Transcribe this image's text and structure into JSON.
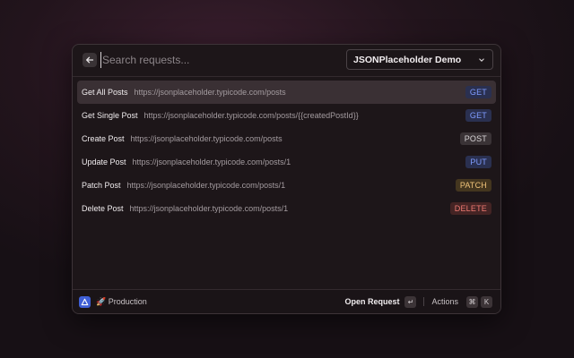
{
  "search": {
    "placeholder": "Search requests..."
  },
  "collection": {
    "selected": "JSONPlaceholder Demo"
  },
  "requests": [
    {
      "name": "Get All Posts",
      "url": "https://jsonplaceholder.typicode.com/posts",
      "method": "GET",
      "selected": true
    },
    {
      "name": "Get Single Post",
      "url": "https://jsonplaceholder.typicode.com/posts/{{createdPostId}}",
      "method": "GET"
    },
    {
      "name": "Create Post",
      "url": "https://jsonplaceholder.typicode.com/posts",
      "method": "POST"
    },
    {
      "name": "Update Post",
      "url": "https://jsonplaceholder.typicode.com/posts/1",
      "method": "PUT"
    },
    {
      "name": "Patch Post",
      "url": "https://jsonplaceholder.typicode.com/posts/1",
      "method": "PATCH"
    },
    {
      "name": "Delete Post",
      "url": "https://jsonplaceholder.typicode.com/posts/1",
      "method": "DELETE"
    }
  ],
  "method_colors": {
    "GET": {
      "fg": "#7f9cff",
      "bg": "#2a3050"
    },
    "POST": {
      "fg": "#d8d4d6",
      "bg": "#3a3336"
    },
    "PUT": {
      "fg": "#7f9cff",
      "bg": "#2a3050"
    },
    "PATCH": {
      "fg": "#f1c47a",
      "bg": "#44361f"
    },
    "DELETE": {
      "fg": "#f07a72",
      "bg": "#442424"
    }
  },
  "footer": {
    "environment_icon": "rocket-icon",
    "environment": "🚀 Production",
    "primary_action": "Open Request",
    "primary_key": "↵",
    "actions_label": "Actions",
    "actions_keys": [
      "⌘",
      "K"
    ]
  }
}
